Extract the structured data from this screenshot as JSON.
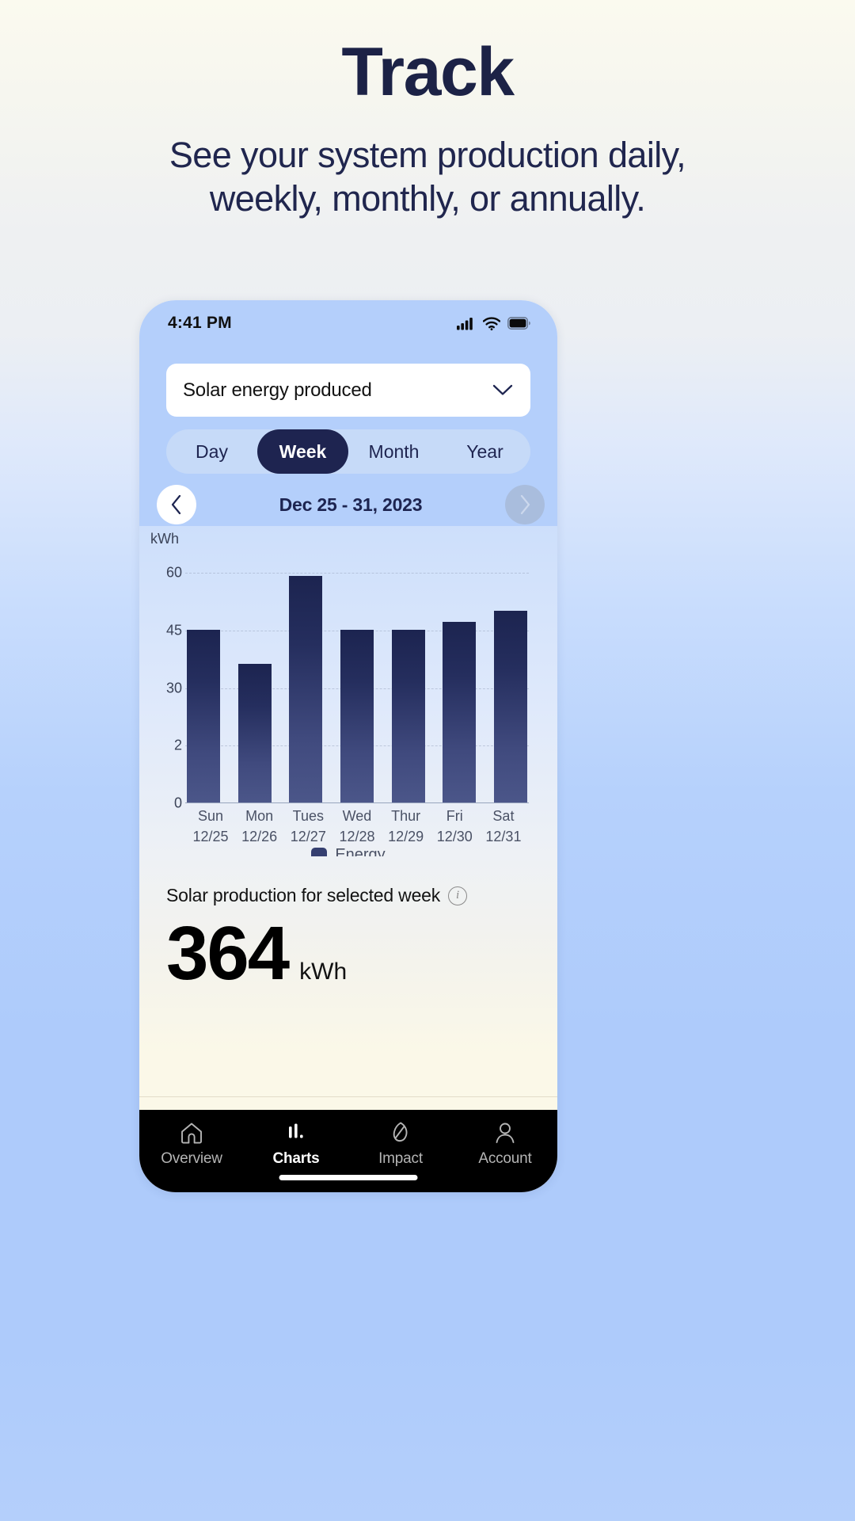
{
  "hero": {
    "title": "Track",
    "subtitle_line1": "See your system production daily,",
    "subtitle_line2": "weekly, monthly, or annually."
  },
  "colors": {
    "brand_navy": "#1e2450",
    "page_bg_top": "#fbfaef",
    "page_bg_bottom": "#aecbfb",
    "app_header_blue": "#b4cffb",
    "bar_top": "#1c2450",
    "bar_bottom": "#4b5689",
    "tabbar_bg": "#000000",
    "accent_active_tab": "#ffffff"
  },
  "status_bar": {
    "time": "4:41 PM",
    "icons": [
      "cellular-signal-icon",
      "wifi-icon",
      "battery-icon"
    ]
  },
  "dropdown": {
    "selected": "Solar energy produced",
    "chevron": "chevron-down-icon"
  },
  "segmented_control": {
    "options": [
      {
        "label": "Day",
        "active": false
      },
      {
        "label": "Week",
        "active": true
      },
      {
        "label": "Month",
        "active": false
      },
      {
        "label": "Year",
        "active": false
      }
    ]
  },
  "date_nav": {
    "prev_icon": "chevron-left-icon",
    "next_icon": "chevron-right-icon",
    "range": "Dec 25 - 31, 2023",
    "next_disabled": true
  },
  "chart_data": {
    "type": "bar",
    "title": "",
    "xlabel": "",
    "ylabel": "kWh",
    "unit_label": "kWh",
    "categories": [
      "Sun",
      "Mon",
      "Tues",
      "Wed",
      "Thur",
      "Fri",
      "Sat"
    ],
    "category_sublabels": [
      "12/25",
      "12/26",
      "12/27",
      "12/28",
      "12/29",
      "12/30",
      "12/31"
    ],
    "values": [
      45,
      36,
      59,
      45,
      45,
      47,
      50
    ],
    "ytick_labels": [
      "60",
      "45",
      "30",
      "2",
      "0"
    ],
    "ytick_values": [
      60,
      45,
      30,
      15,
      0
    ],
    "ylim": [
      0,
      66
    ],
    "grid": true,
    "legend": {
      "position": "bottom",
      "entries": [
        "Energy"
      ]
    }
  },
  "summary": {
    "label": "Solar production for selected week",
    "info_icon": "info-icon",
    "value": "364",
    "unit": "kWh"
  },
  "tabbar": {
    "items": [
      {
        "label": "Overview",
        "icon": "home-icon",
        "active": false
      },
      {
        "label": "Charts",
        "icon": "bar-chart-icon",
        "active": true
      },
      {
        "label": "Impact",
        "icon": "leaf-icon",
        "active": false
      },
      {
        "label": "Account",
        "icon": "person-icon",
        "active": false
      }
    ]
  }
}
